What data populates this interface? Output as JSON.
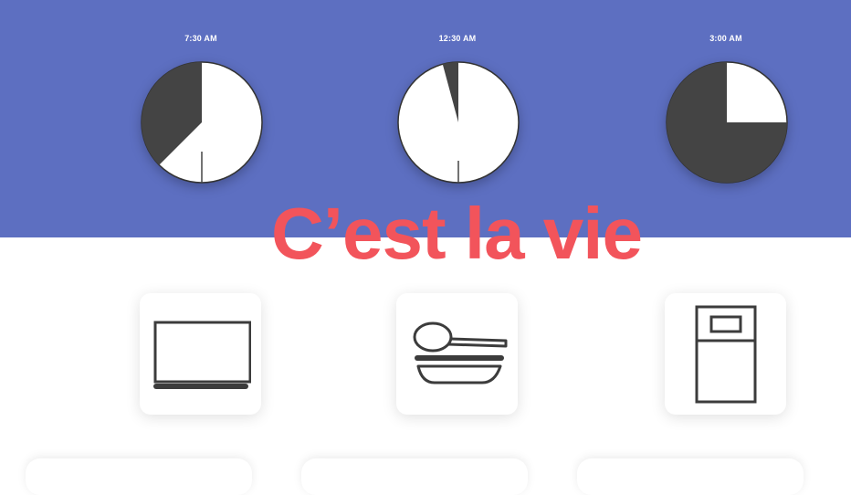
{
  "title": "C’est la vie",
  "colors": {
    "hero_background": "#5d6fc1",
    "title": "#f2545b",
    "clock_dark": "#444444",
    "clock_light": "#ffffff"
  },
  "clocks": [
    {
      "time": "7:30 AM",
      "dark_fraction": 0.375
    },
    {
      "time": "12:30 AM",
      "dark_fraction": 0.042
    },
    {
      "time": "3:00 AM",
      "dark_fraction": 0.75
    }
  ],
  "activities": [
    {
      "icon": "laptop-icon"
    },
    {
      "icon": "spoon-plate-icon"
    },
    {
      "icon": "bed-icon"
    }
  ]
}
